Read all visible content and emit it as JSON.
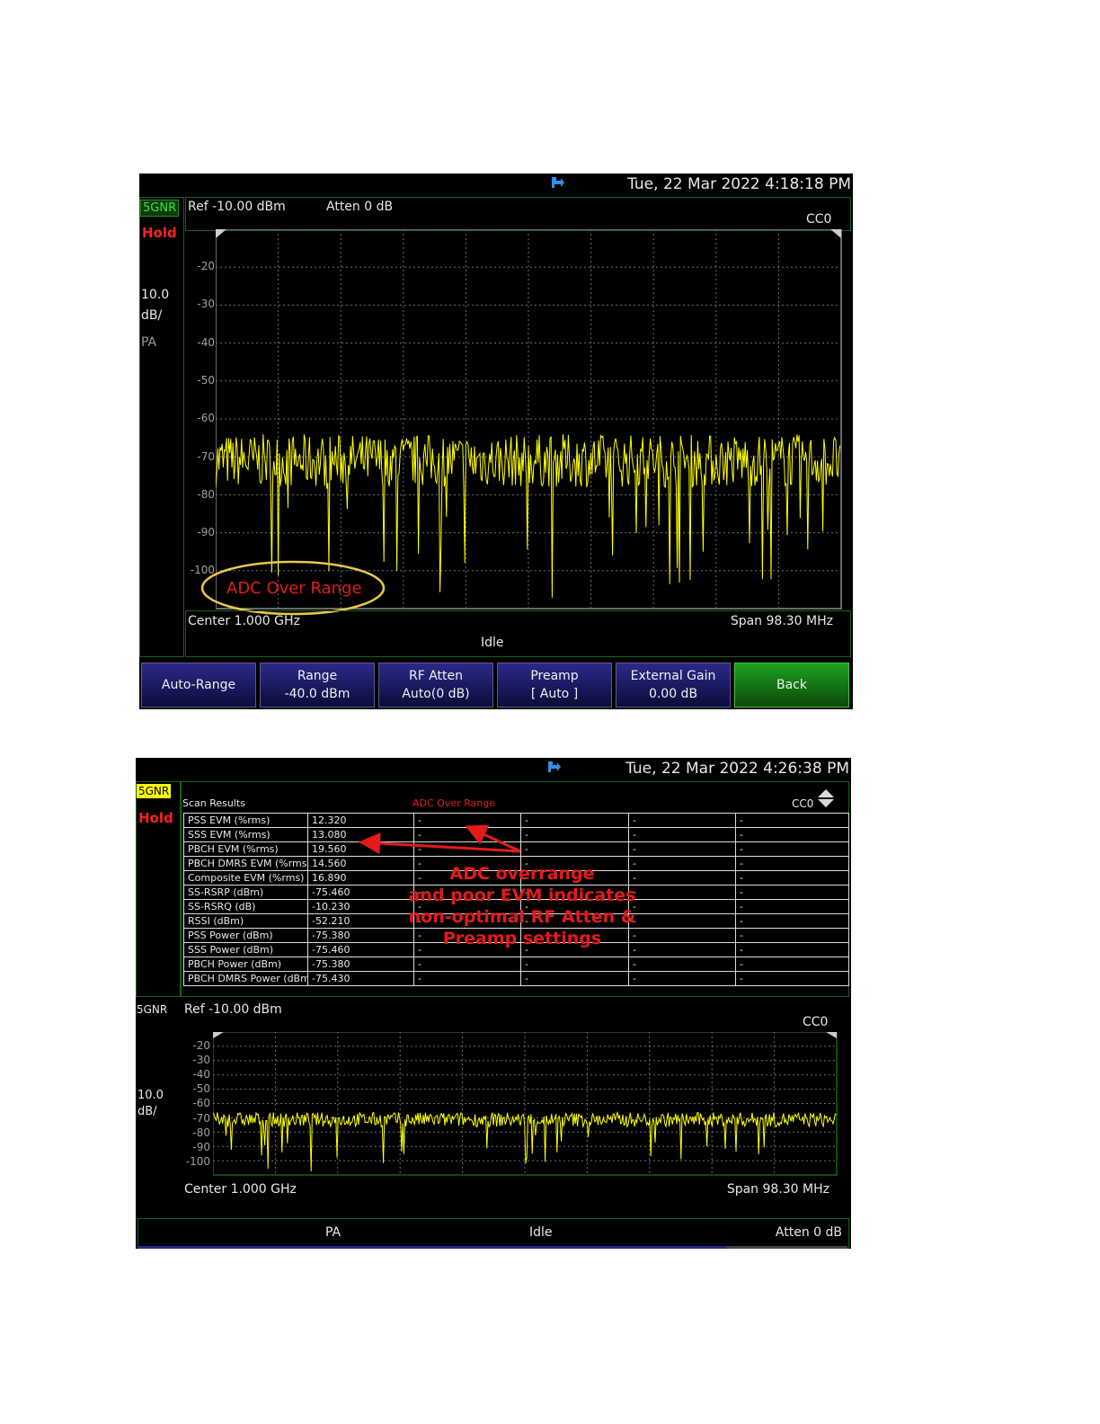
{
  "screen1": {
    "datetime": "Tue, 22 Mar 2022 4:18:18 PM",
    "badge": "5GNR",
    "hold": "Hold",
    "ref": "Ref -10.00  dBm",
    "atten": "Atten 0  dB",
    "carrier": "CC0",
    "scale_value": "10.0",
    "scale_unit": "dB/",
    "mode": "PA",
    "y_ticks": [
      "-20",
      "-30",
      "-40",
      "-50",
      "-60",
      "-70",
      "-80",
      "-90",
      "-100"
    ],
    "adc_warning": "ADC Over Range",
    "center": "Center 1.000 GHz",
    "span": "Span 98.30 MHz",
    "status": "Idle",
    "softkeys": [
      {
        "line1": "Auto-Range",
        "line2": ""
      },
      {
        "line1": "Range",
        "line2": "-40.0 dBm"
      },
      {
        "line1": "RF Atten",
        "line2": "Auto(0 dB)"
      },
      {
        "line1": "Preamp",
        "line2": "[ Auto ]"
      },
      {
        "line1": "External Gain",
        "line2": "0.00 dB"
      },
      {
        "line1": "Back",
        "line2": ""
      }
    ],
    "colors": {
      "trace": "#ffff00",
      "grid": "#5e5e5e",
      "ellipse": "#e8c84a"
    }
  },
  "screen2": {
    "datetime": "Tue, 22 Mar 2022 4:26:38 PM",
    "badge": "5GNR",
    "hold": "Hold",
    "scan_title": "Scan Results",
    "adc_warning": "ADC Over Range",
    "carrier": "CC0",
    "table_rows": [
      [
        "PSS EVM (%rms)",
        "12.320",
        "-",
        "-",
        "-",
        "-"
      ],
      [
        "SSS EVM (%rms)",
        "13.080",
        "-",
        "-",
        "-",
        "-"
      ],
      [
        "PBCH EVM (%rms)",
        "19.560",
        "-",
        "-",
        "-",
        "-"
      ],
      [
        "PBCH DMRS EVM (%rms)",
        "14.560",
        "-",
        "-",
        "-",
        "-"
      ],
      [
        "Composite EVM (%rms)",
        "16.890",
        "-",
        "-",
        "-",
        "-"
      ],
      [
        "SS-RSRP (dBm)",
        "-75.460",
        "-",
        "-",
        "-",
        "-"
      ],
      [
        "SS-RSRQ (dB)",
        "-10.230",
        "-",
        "-",
        "-",
        "-"
      ],
      [
        "RSSI (dBm)",
        "-52.210",
        "-",
        "-",
        "-",
        "-"
      ],
      [
        "PSS Power (dBm)",
        "-75.380",
        "-",
        "-",
        "-",
        "-"
      ],
      [
        "SSS Power (dBm)",
        "-75.460",
        "-",
        "-",
        "-",
        "-"
      ],
      [
        "PBCH Power (dBm)",
        "-75.380",
        "-",
        "-",
        "-",
        "-"
      ],
      [
        "PBCH DMRS Power (dBm)",
        "-75.430",
        "-",
        "-",
        "-",
        "-"
      ]
    ],
    "annotation": [
      "ADC overrange",
      "and poor EVM indicates",
      "non-optimal RF Atten &",
      "Preamp settings"
    ],
    "lower_badge": "5GNR",
    "ref": "Ref -10.00  dBm",
    "lower_carrier": "CC0",
    "scale_value": "10.0",
    "scale_unit": "dB/",
    "y_ticks": [
      "-20",
      "-30",
      "-40",
      "-50",
      "-60",
      "-70",
      "-80",
      "-90",
      "-100"
    ],
    "center": "Center 1.000 GHz",
    "span": "Span 98.30 MHz",
    "status_mode": "PA",
    "status": "Idle",
    "status_atten": "Atten 0  dB",
    "colors": {
      "annotation": "#e41b1b",
      "trace": "#ffff00"
    }
  }
}
